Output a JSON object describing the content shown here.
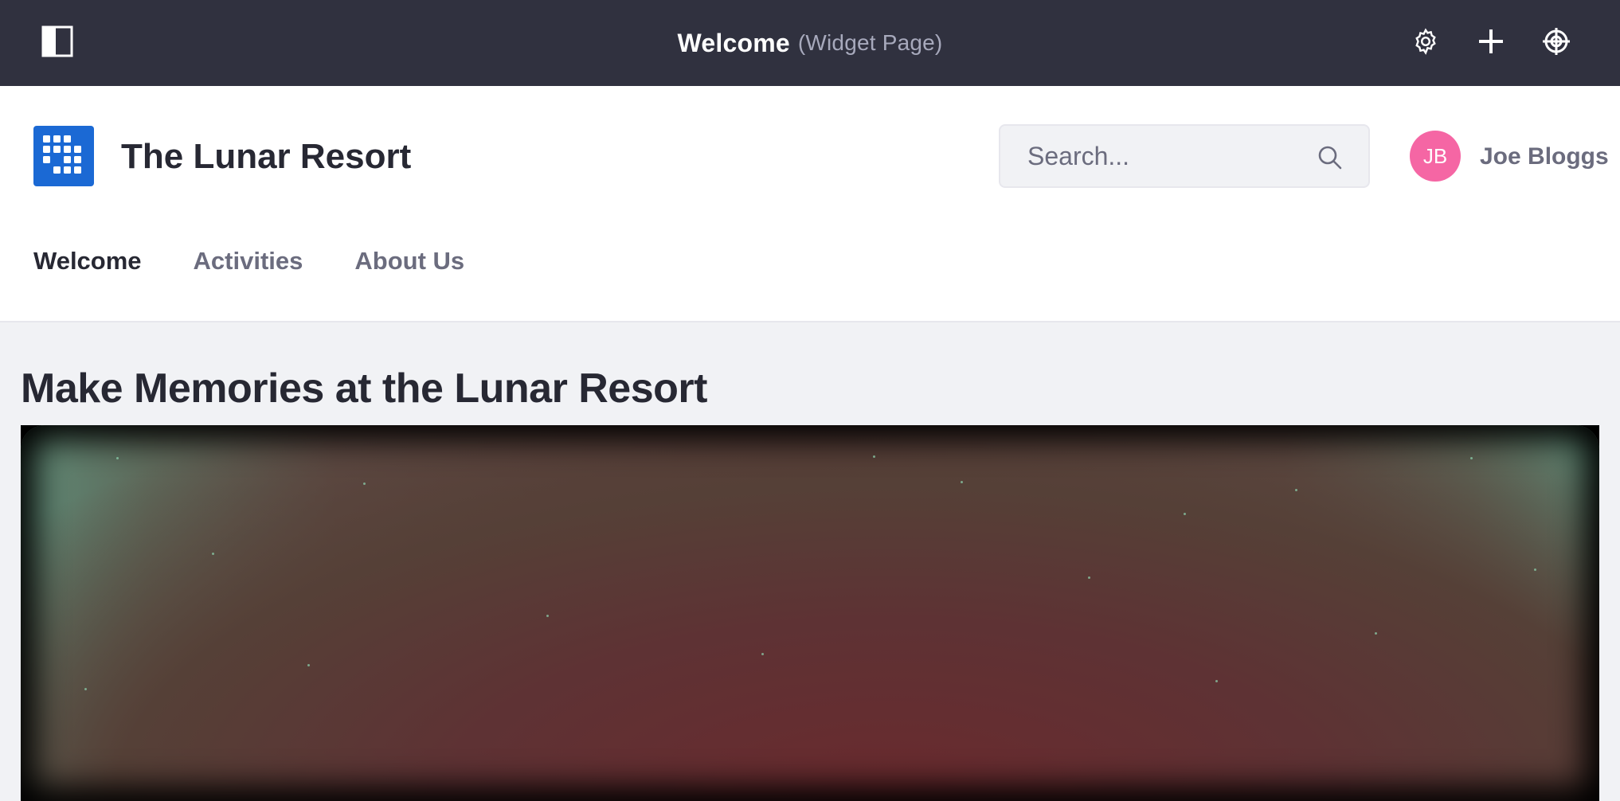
{
  "control_bar": {
    "title": "Welcome",
    "subtitle": "(Widget Page)",
    "icons": [
      "panel-toggle-icon",
      "gear-icon",
      "plus-icon",
      "target-icon"
    ]
  },
  "header": {
    "site_name": "The Lunar Resort",
    "search": {
      "placeholder": "Search...",
      "value": ""
    },
    "user": {
      "initials": "JB",
      "name": "Joe Bloggs",
      "avatar_color": "#f566a4"
    },
    "nav": [
      {
        "label": "Welcome",
        "active": true
      },
      {
        "label": "Activities",
        "active": false
      },
      {
        "label": "About Us",
        "active": false
      }
    ]
  },
  "main": {
    "heading": "Make Memories at the Lunar Resort"
  },
  "colors": {
    "control_bar": "#30313f",
    "brand": "#1b69d4",
    "page_bg": "#f1f2f5",
    "text_dark": "#272833",
    "text_muted": "#6b6c7e"
  }
}
